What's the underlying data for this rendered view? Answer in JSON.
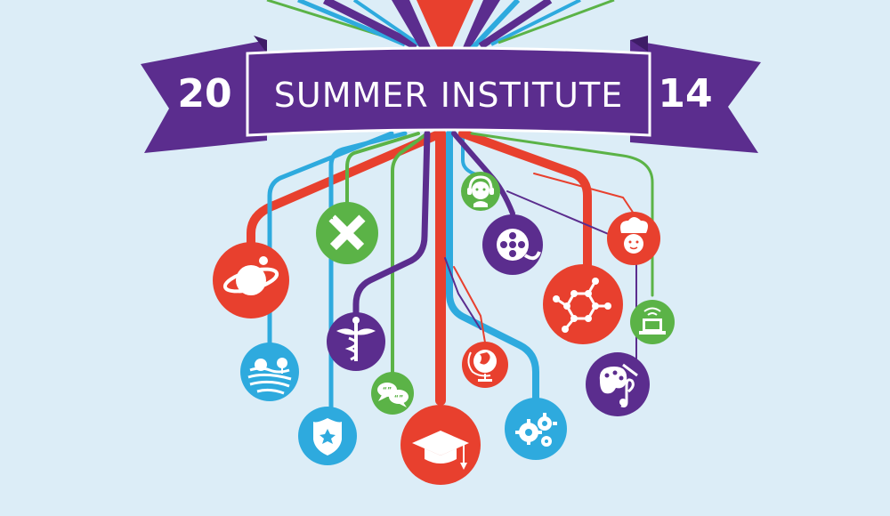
{
  "banner": {
    "year_left": "20",
    "title": "SUMMER INSTITUTE",
    "year_right": "14"
  },
  "colors": {
    "background": "#dcedf7",
    "purple": "#5b2d8e",
    "red": "#e8402e",
    "blue": "#2eaade",
    "green": "#5bb347"
  },
  "icons": [
    "planet-icon",
    "pencil-ruler-icon",
    "caduceus-icon",
    "farm-landscape-icon",
    "speech-bubbles-icon",
    "police-badge-icon",
    "graduation-cap-icon",
    "globe-icon",
    "gears-icon",
    "headset-person-icon",
    "film-reel-icon",
    "chef-icon",
    "molecule-icon",
    "laptop-wifi-icon",
    "art-music-icon"
  ]
}
